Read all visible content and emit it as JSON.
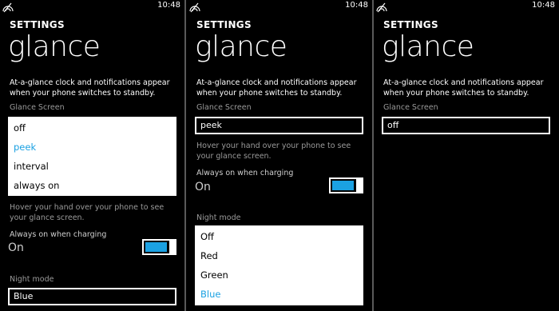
{
  "status": {
    "time": "10:48",
    "signal_icon": "no-signal-icon"
  },
  "header": {
    "section": "SETTINGS",
    "title": "glance"
  },
  "description": "At-a-glance clock and notifications appear when your phone switches to standby.",
  "glance_screen": {
    "label": "Glance Screen",
    "options": [
      "off",
      "peek",
      "interval",
      "always on"
    ],
    "hint": "Hover your hand over your phone to see your glance screen."
  },
  "charging": {
    "label": "Always on when charging",
    "state": "On"
  },
  "night_mode": {
    "label": "Night mode",
    "options": [
      "Off",
      "Red",
      "Green",
      "Blue"
    ]
  },
  "screens": [
    {
      "glance_value": "peek",
      "night_value": "Blue"
    },
    {
      "glance_value": "peek",
      "night_value": "Blue"
    },
    {
      "glance_value": "off"
    }
  ],
  "colors": {
    "accent": "#1ba1e2",
    "background": "#000000",
    "secondary_text": "#9a9a9a"
  }
}
